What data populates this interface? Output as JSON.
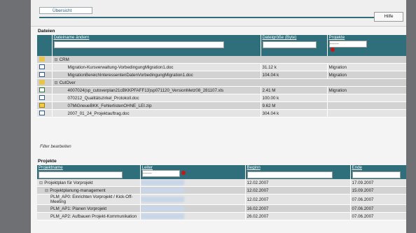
{
  "toolbar": {
    "tab": "Übersicht",
    "help": "Hilfe"
  },
  "dateien": {
    "title": "Dateien",
    "headers": [
      "Dateiname ändern",
      "Dateigröße (Byte)",
      "Projekte"
    ],
    "project_filter": "--------",
    "rows": [
      {
        "type": "group",
        "icon": "folder-icon",
        "name": "CRM"
      },
      {
        "type": "file",
        "icon": "word-document-icon",
        "name": "Migration-Kursverwaltung-VorbedingungMigration1.doc",
        "size": "31.12 k",
        "project": "Migration"
      },
      {
        "type": "file",
        "icon": "word-document-icon",
        "name": "MigrationBereichInteressentenDatenVorbedingungMigration1.doc",
        "size": "104.04 k",
        "project": "Migration"
      },
      {
        "type": "group",
        "icon": "folder-icon",
        "name": "CutOver"
      },
      {
        "type": "file",
        "icon": "excel-document-icon",
        "name": "4007024(sp_cutoverplan21cBKKPFAFF13)sp071120_VersionMetz08_281107.xls",
        "size": "2.41 M",
        "project": "Migration"
      },
      {
        "type": "file",
        "icon": "word-document-icon",
        "name": "070212_Qualitätszirkel_Protokoll.doc",
        "size": "100.00 k",
        "project": ""
      },
      {
        "type": "file",
        "icon": "zip-file-icon",
        "name": "07MiGneueBKK_FehlerlistenOHNE_LEI.zip",
        "size": "9.62 M",
        "project": ""
      },
      {
        "type": "file",
        "icon": "word-document-icon",
        "name": "2007_01_24_Projektauftrag.doc",
        "size": "304.04 k",
        "project": ""
      }
    ],
    "filter_text": "Filter bearbeiten"
  },
  "projekte": {
    "title": "Projekte",
    "headers": [
      "Projektname",
      "Leiter",
      "Beginn",
      "Ende"
    ],
    "leiter_select": "--------",
    "rows": [
      {
        "name": "Projektplan für Vorprojekt",
        "indent": 0,
        "begin": "12.02.2007",
        "end": "17.09.2007"
      },
      {
        "name": "Projektplanung-management",
        "indent": 1,
        "begin": "12.02.2007",
        "end": "15.09.2007"
      },
      {
        "name": "PLM_AP0: Einrichten Vorprojekt / Kick-Off-Meeting",
        "indent": 2,
        "begin": "12.02.2007",
        "end": "07.06.2007"
      },
      {
        "name": "PLM_AP1: Planen Vorprojekt",
        "indent": 2,
        "begin": "16.02.2007",
        "end": "07.06.2007"
      },
      {
        "name": "PLM_AP2: Aufbauen Projekt-Kommunikation",
        "indent": 2,
        "begin": "26.02.2007",
        "end": "07.06.2007"
      }
    ]
  }
}
